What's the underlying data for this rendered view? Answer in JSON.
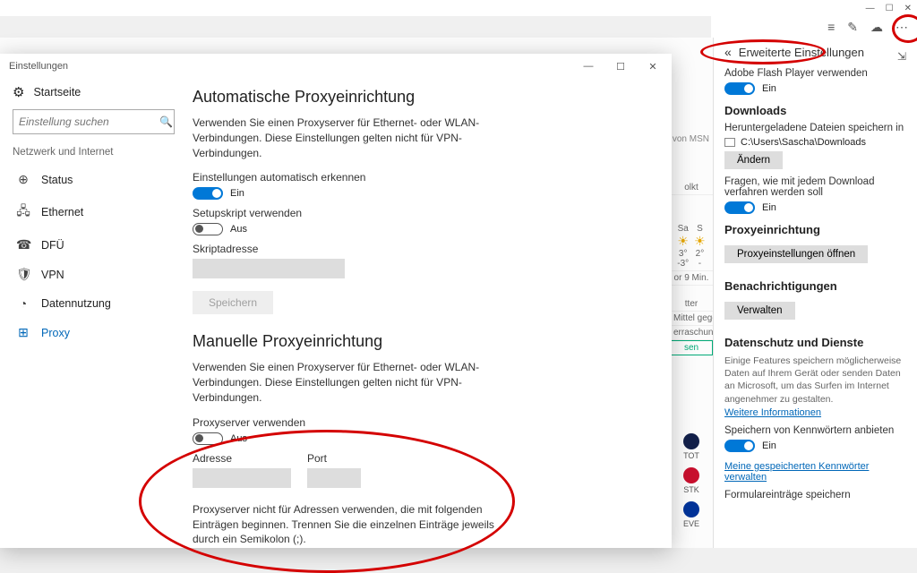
{
  "browser": {
    "tools": {
      "menu_icon": "⋯",
      "write_icon": "✎",
      "cloud_icon": "☁",
      "lines_icon": "≡"
    },
    "window_controls": {
      "min": "—",
      "max": "☐",
      "close": "✕"
    }
  },
  "edge_panel": {
    "back_icon": "«",
    "header": "Erweiterte Einstellungen",
    "pin_icon": "⇲",
    "flash_label": "Adobe Flash Player verwenden",
    "flash_state": "Ein",
    "downloads_heading": "Downloads",
    "downloads_path_label": "Heruntergeladene Dateien speichern in",
    "downloads_path": "C:\\Users\\Sascha\\Downloads",
    "change_btn": "Ändern",
    "ask_each_label": "Fragen, wie mit jedem Download verfahren werden soll",
    "ask_each_state": "Ein",
    "proxy_heading": "Proxyeinrichtung",
    "proxy_btn": "Proxyeinstellungen öffnen",
    "notif_heading": "Benachrichtigungen",
    "notif_btn": "Verwalten",
    "privacy_heading": "Datenschutz und Dienste",
    "privacy_desc": "Einige Features speichern möglicherweise Daten auf Ihrem Gerät oder senden Daten an Microsoft, um das Surfen im Internet angenehmer zu gestalten.",
    "privacy_link": "Weitere Informationen",
    "save_pw_label": "Speichern von Kennwörtern anbieten",
    "save_pw_state": "Ein",
    "manage_pw_link": "Meine gespeicherten Kennwörter verwalten",
    "forms_label": "Formulareinträge speichern"
  },
  "bg": {
    "msn_text": "tgestellt von MSN",
    "weather_day1": "Sa",
    "weather_day2": "S",
    "temp_hi1": "3°",
    "temp_lo1": "-3°",
    "temp_hi2": "2°",
    "temp_lo2": "-",
    "update": "or 9 Min.",
    "wetter": "tter",
    "mittel": "Mittel gegen",
    "uber": "erraschungen.",
    "sen": "sen",
    "jolkt": "olkt",
    "team1": "TOT",
    "team2": "STK",
    "team3": "EVE"
  },
  "settings": {
    "window_title": "Einstellungen",
    "home": "Startseite",
    "search_placeholder": "Einstellung suchen",
    "section": "Netzwerk und Internet",
    "nav": {
      "status": "Status",
      "ethernet": "Ethernet",
      "dfu": "DFÜ",
      "vpn": "VPN",
      "data": "Datennutzung",
      "proxy": "Proxy"
    },
    "auto_heading": "Automatische Proxyeinrichtung",
    "auto_desc": "Verwenden Sie einen Proxyserver für Ethernet- oder WLAN-Verbindungen. Diese Einstellungen gelten nicht für VPN-Verbindungen.",
    "detect_label": "Einstellungen automatisch erkennen",
    "detect_state": "Ein",
    "script_toggle_label": "Setupskript verwenden",
    "script_toggle_state": "Aus",
    "script_addr_label": "Skriptadresse",
    "save_btn": "Speichern",
    "manual_heading": "Manuelle Proxyeinrichtung",
    "manual_desc": "Verwenden Sie einen Proxyserver für Ethernet- oder WLAN-Verbindungen. Diese Einstellungen gelten nicht für VPN-Verbindungen.",
    "use_proxy_label": "Proxyserver verwenden",
    "use_proxy_state": "Aus",
    "addr_label": "Adresse",
    "port_label": "Port",
    "exclude_label": "Proxyserver nicht für Adressen verwenden, die mit folgenden Einträgen beginnen. Trennen Sie die einzelnen Einträge jeweils durch ein Semikolon (;)."
  }
}
